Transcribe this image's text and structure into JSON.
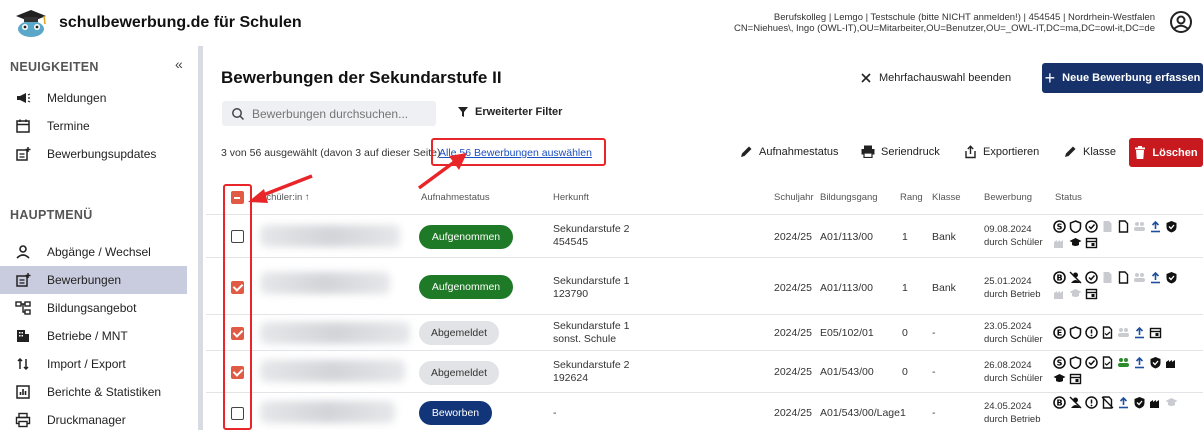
{
  "header": {
    "app_title": "schulbewerbung.de für Schulen",
    "user_line1": "Berufskolleg | Lemgo | Testschule (bitte NICHT anmelden!) | 454545 | Nordrhein-Westfalen",
    "user_line2": "CN=Niehues\\, Ingo (OWL-IT),OU=Mitarbeiter,OU=Benutzer,OU=_OWL-IT,DC=ma,DC=owl-it,DC=de"
  },
  "sidebar": {
    "section_news": "NEUIGKEITEN",
    "news_items": [
      {
        "label": "Meldungen",
        "icon": "megaphone-icon"
      },
      {
        "label": "Termine",
        "icon": "calendar-icon"
      },
      {
        "label": "Bewerbungsupdates",
        "icon": "update-icon"
      }
    ],
    "section_main": "HAUPTMENÜ",
    "main_items": [
      {
        "label": "Abgänge / Wechsel",
        "icon": "person-icon"
      },
      {
        "label": "Bewerbungen",
        "icon": "application-icon",
        "active": true
      },
      {
        "label": "Bildungsangebot",
        "icon": "tree-icon"
      },
      {
        "label": "Betriebe / MNT",
        "icon": "building-icon"
      },
      {
        "label": "Import / Export",
        "icon": "import-export-icon"
      },
      {
        "label": "Berichte & Statistiken",
        "icon": "chart-icon"
      },
      {
        "label": "Druckmanager",
        "icon": "printer-icon"
      }
    ]
  },
  "main": {
    "title": "Bewerbungen der Sekundarstufe II",
    "end_multi_label": "Mehrfachauswahl beenden",
    "new_label": "Neue Bewerbung erfassen",
    "search_placeholder": "Bewerbungen durchsuchen...",
    "filter_label": "Erweiterter Filter",
    "selection_info": "3 von 56 ausgewählt (davon 3 auf dieser Seite)",
    "select_all_label": "Alle 56 Bewerbungen auswählen",
    "actions": {
      "status": "Aufnahmestatus",
      "serial": "Seriendruck",
      "export": "Exportieren",
      "class": "Klasse",
      "delete": "Löschen"
    },
    "columns": {
      "student": "Schüler:in ↑",
      "status": "Aufnahmestatus",
      "origin": "Herkunft",
      "year": "Schuljahr",
      "course": "Bildungsgang",
      "rank": "Rang",
      "class": "Klasse",
      "application": "Bewerbung",
      "state": "Status"
    },
    "rows": [
      {
        "checked": false,
        "status": "Aufgenommen",
        "status_kind": "green",
        "origin1": "Sekundarstufe 2",
        "origin2": "454545",
        "year": "2024/25",
        "course": "A01/113/00",
        "rank": "1",
        "class": "Bank",
        "date": "09.08.2024",
        "by": "durch Schüler"
      },
      {
        "checked": true,
        "status": "Aufgenommen",
        "status_kind": "green",
        "origin1": "Sekundarstufe 1",
        "origin2": "123790",
        "year": "2024/25",
        "course": "A01/113/00",
        "rank": "1",
        "class": "Bank",
        "date": "25.01.2024",
        "by": "durch Betrieb"
      },
      {
        "checked": true,
        "status": "Abgemeldet",
        "status_kind": "grey",
        "origin1": "Sekundarstufe 1",
        "origin2": "sonst. Schule",
        "year": "2024/25",
        "course": "E05/102/01",
        "rank": "0",
        "class": "-",
        "date": "23.05.2024",
        "by": "durch Schüler"
      },
      {
        "checked": true,
        "status": "Abgemeldet",
        "status_kind": "grey",
        "origin1": "Sekundarstufe 2",
        "origin2": "192624",
        "year": "2024/25",
        "course": "A01/543/00",
        "rank": "0",
        "class": "-",
        "date": "26.08.2024",
        "by": "durch Schüler"
      },
      {
        "checked": false,
        "status": "Beworben",
        "status_kind": "blue",
        "origin1": "-",
        "origin2": "",
        "year": "2024/25",
        "course": "A01/543/00/Lage1",
        "rank": "",
        "class": "-",
        "date": "24.05.2024",
        "by": "durch Betrieb"
      }
    ]
  },
  "colors": {
    "primary": "#17326b",
    "danger": "#c8191f",
    "accent": "#e05a44",
    "success": "#1f7a27",
    "highlight": "#e8262a"
  }
}
